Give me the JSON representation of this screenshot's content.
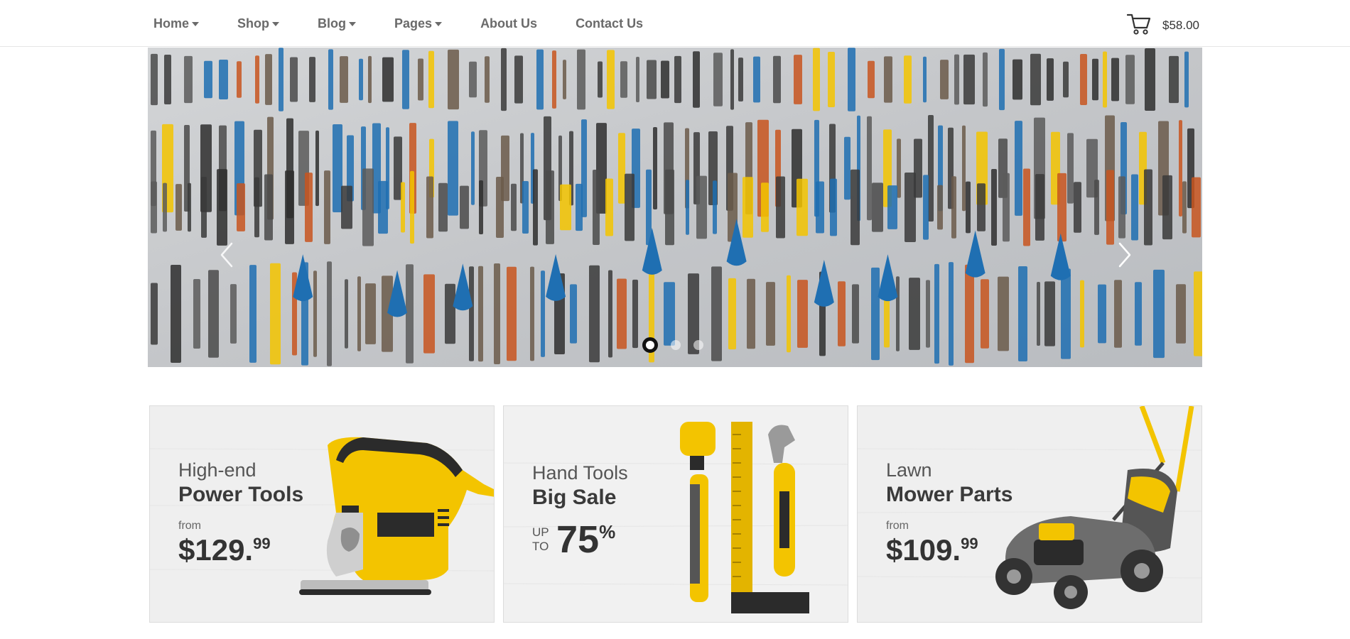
{
  "nav": {
    "items": [
      {
        "label": "Home",
        "has_dropdown": true
      },
      {
        "label": "Shop",
        "has_dropdown": true
      },
      {
        "label": "Blog",
        "has_dropdown": true
      },
      {
        "label": "Pages",
        "has_dropdown": true
      },
      {
        "label": "About Us",
        "has_dropdown": false
      },
      {
        "label": "Contact Us",
        "has_dropdown": false
      }
    ]
  },
  "cart": {
    "icon": "cart-icon",
    "total": "$58.00"
  },
  "hero": {
    "slide_count": 3,
    "active_slide": 1,
    "prev_icon": "chevron-left-icon",
    "next_icon": "chevron-right-icon",
    "image": "tool-wall-image"
  },
  "promos": [
    {
      "kicker": "High-end",
      "title": "Power Tools",
      "from_label": "from",
      "price_main": "$129.",
      "price_cents": "99",
      "image": "jigsaw-image"
    },
    {
      "kicker": "Hand Tools",
      "title": "Big Sale",
      "up_label": "UP",
      "to_label": "TO",
      "discount_value": "75",
      "discount_unit": "%",
      "image": "hand-tools-image"
    },
    {
      "kicker": "Lawn",
      "title": "Mower Parts",
      "from_label": "from",
      "price_main": "$109.",
      "price_cents": "99",
      "image": "lawn-mower-image"
    }
  ],
  "colors": {
    "accent_yellow": "#f2c200",
    "tool_blue": "#1f6fb2",
    "text_dark": "#333333",
    "nav_text": "#6a6a6a"
  }
}
